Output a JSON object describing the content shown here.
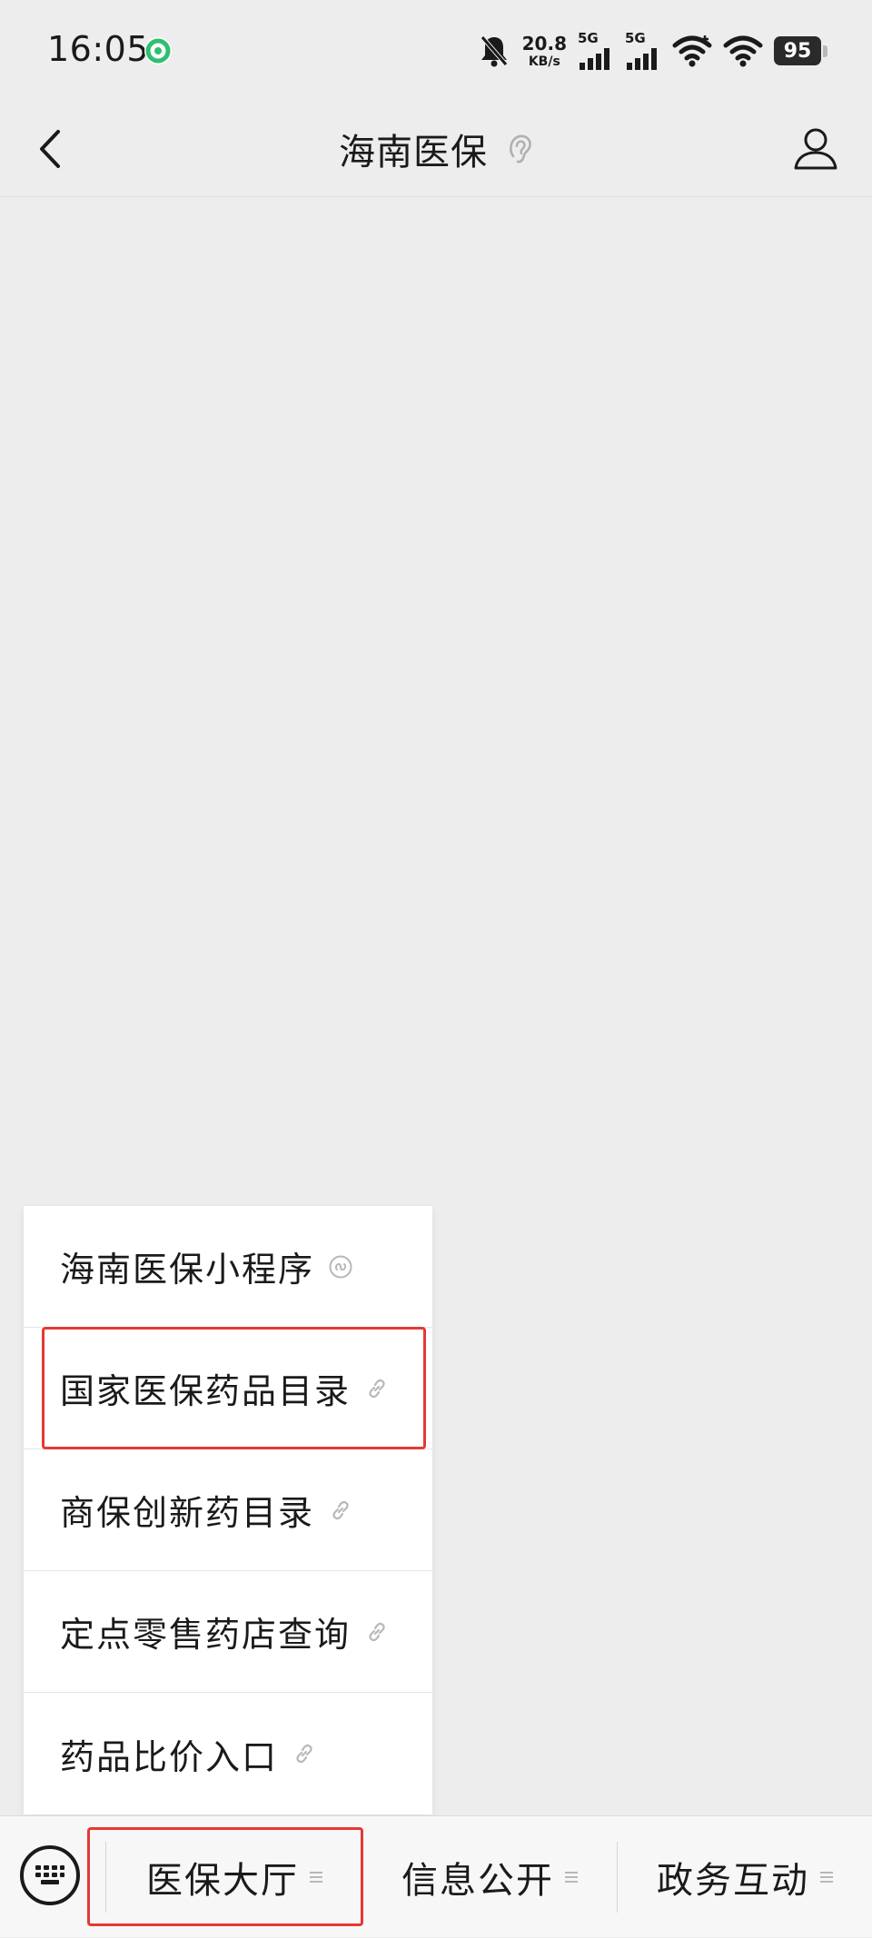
{
  "status_bar": {
    "time": "16:05",
    "net_speed_value": "20.8",
    "net_speed_unit": "KB/s",
    "signal_1": "5G",
    "signal_2": "5G",
    "battery": "95"
  },
  "header": {
    "title": "海南医保"
  },
  "submenu": {
    "items": [
      {
        "label": "海南医保小程序",
        "icon": "mini-program-icon"
      },
      {
        "label": "国家医保药品目录",
        "icon": "link-icon"
      },
      {
        "label": "商保创新药目录",
        "icon": "link-icon"
      },
      {
        "label": "定点零售药店查询",
        "icon": "link-icon"
      },
      {
        "label": "药品比价入口",
        "icon": "link-icon"
      }
    ]
  },
  "menu_bar": {
    "tabs": [
      {
        "label": "医保大厅"
      },
      {
        "label": "信息公开"
      },
      {
        "label": "政务互动"
      }
    ]
  },
  "colors": {
    "background": "#ededed",
    "highlight": "#e53935",
    "app_icon": "#2fbf71"
  }
}
